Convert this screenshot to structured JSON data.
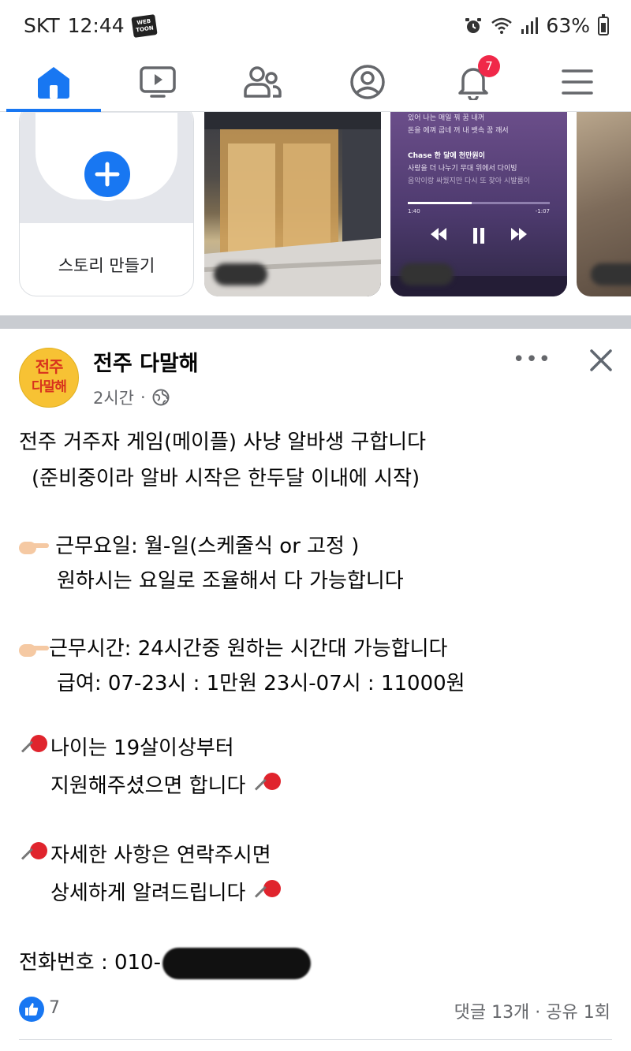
{
  "status_bar": {
    "carrier": "SKT",
    "time": "12:44",
    "app_badge": "WEB TOON",
    "battery": "63%"
  },
  "nav": {
    "items": [
      {
        "name": "home",
        "active": true
      },
      {
        "name": "watch",
        "active": false
      },
      {
        "name": "friends",
        "active": false
      },
      {
        "name": "profile",
        "active": false
      },
      {
        "name": "notifications",
        "active": false
      },
      {
        "name": "menu",
        "active": false
      }
    ],
    "notification_count": "7",
    "accent_color": "#1877f2"
  },
  "stories": {
    "create_label": "스토리 만들기",
    "music_story": {
      "lines": [
        "있어 나는 매일 꿔 꿈 내꺼",
        "돈을 에껴 굽네 꺼 내 뱃속 꿈 깨서",
        "Chase 한 달에 천만원이",
        "사랑을 더 나누기 무대 위에서 다이빙",
        "음악이랑 싸웠지만 다시 또 찾아 시발롬이"
      ],
      "time_start": "1:40",
      "time_end": "-1:07"
    }
  },
  "post": {
    "author": "전주 다말해",
    "avatar_text_line1": "전주",
    "avatar_text_line2": "다말해",
    "timestamp": "2시간",
    "separator": "·",
    "more_label": "•••",
    "body": {
      "line1": "전주 거주자 게임(메이플) 사냥 알바생 구합니다",
      "line2": " (준비중이라 알바 시작은 한두달 이내에 시작)",
      "line3": "근무요일: 월-일(스케줄식 or 고정 )",
      "line4": "원하시는 요일로 조율해서 다 가능합니다",
      "line5": "근무시간: 24시간중 원하는 시간대 가능합니다",
      "line6": "급여: 07-23시 : 1만원 23시-07시 : 11000원",
      "line7": "나이는 19살이상부터",
      "line8": "지원해주셨으면 합니다",
      "line9": "자세한 사항은 연락주시면",
      "line10": "상세하게 알려드립니다",
      "line11": "전화번호 : 010-"
    },
    "likes": "7",
    "stats": "댓글 13개 · 공유 1회"
  }
}
